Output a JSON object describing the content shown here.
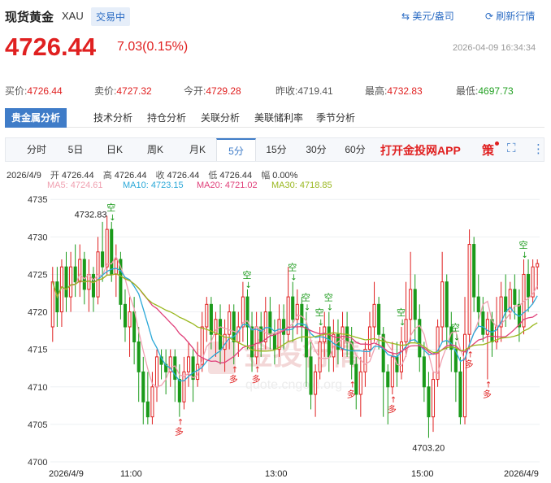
{
  "header": {
    "title": "现货黄金",
    "symbol": "XAU",
    "status": "交易中",
    "unit_label": "美元/盎司",
    "refresh_label": "刷新行情"
  },
  "quote": {
    "price": "4726.44",
    "change": "7.03(0.15%)",
    "timestamp": "2026-04-09 16:34:34"
  },
  "stats": [
    {
      "label": "买价:",
      "value": "4726.44",
      "color": "red"
    },
    {
      "label": "卖价:",
      "value": "4727.32",
      "color": "red"
    },
    {
      "label": "今开:",
      "value": "4729.28",
      "color": "red"
    },
    {
      "label": "昨收:",
      "value": "4719.41",
      "color": "plain"
    },
    {
      "label": "最高:",
      "value": "4732.83",
      "color": "red"
    },
    {
      "label": "最低:",
      "value": "4697.73",
      "color": "green"
    }
  ],
  "analysis_tabs": [
    "贵金属分析",
    "技术分析",
    "持仓分析",
    "关联分析",
    "美联储利率",
    "季节分析"
  ],
  "period_tabs": [
    "分时",
    "5日",
    "日K",
    "周K",
    "月K",
    "5分",
    "15分",
    "30分",
    "60分"
  ],
  "active_period": "5分",
  "app_link": "打开金投网APP",
  "policy_label": "策",
  "ohlc": {
    "date": "2026/4/9",
    "open_label": "开",
    "open": "4726.44",
    "high_label": "高",
    "high": "4726.44",
    "close_label": "收",
    "close": "4726.44",
    "low_label": "低",
    "low": "4726.44",
    "amp_label": "幅",
    "amp": "0.00%"
  },
  "ma": [
    {
      "label": "MA5: 4724.61",
      "color": "#f0a0b0"
    },
    {
      "label": "MA10: 4723.15",
      "color": "#2aa8d8"
    },
    {
      "label": "MA20: 4721.02",
      "color": "#e0407a"
    },
    {
      "label": "MA30: 4718.85",
      "color": "#9ab820"
    }
  ],
  "watermark": {
    "text": "金投行情",
    "url": "quote.cngold.org"
  },
  "chart_data": {
    "type": "candlestick",
    "y_ticks": [
      "4735",
      "4730",
      "4725",
      "4720",
      "4715",
      "4710",
      "4705",
      "4700"
    ],
    "ylim": [
      4700,
      4736
    ],
    "x_labels": [
      "2026/4/9",
      "11:00",
      "13:00",
      "15:00",
      "2026/4/9"
    ],
    "high_annotation": "4732.83",
    "low_annotation": "4703.20",
    "signals": {
      "short": "空",
      "long": "多"
    },
    "candles": [
      [
        4718,
        4724,
        4716,
        4726
      ],
      [
        4724,
        4720,
        4718,
        4726
      ],
      [
        4720,
        4726,
        4718,
        4727
      ],
      [
        4726,
        4722,
        4720,
        4728
      ],
      [
        4722,
        4726,
        4720,
        4728
      ],
      [
        4726,
        4724,
        4722,
        4729
      ],
      [
        4724,
        4727,
        4722,
        4729
      ],
      [
        4727,
        4723,
        4721,
        4728
      ],
      [
        4723,
        4725,
        4720,
        4727
      ],
      [
        4725,
        4722,
        4720,
        4726
      ],
      [
        4722,
        4728,
        4721,
        4730
      ],
      [
        4728,
        4726,
        4724,
        4732
      ],
      [
        4726,
        4731,
        4725,
        4732.8
      ],
      [
        4731,
        4725,
        4724,
        4732
      ],
      [
        4725,
        4727,
        4722,
        4729
      ],
      [
        4727,
        4721,
        4719,
        4728
      ],
      [
        4721,
        4718,
        4716,
        4723
      ],
      [
        4718,
        4720,
        4714,
        4722
      ],
      [
        4720,
        4716,
        4713,
        4722
      ],
      [
        4716,
        4712,
        4708,
        4718
      ],
      [
        4712,
        4708,
        4705,
        4714
      ],
      [
        4708,
        4706,
        4705,
        4712
      ],
      [
        4706,
        4710,
        4705,
        4712
      ],
      [
        4710,
        4714,
        4708,
        4715
      ],
      [
        4714,
        4713,
        4711,
        4715
      ],
      [
        4713,
        4712,
        4709,
        4715
      ],
      [
        4712,
        4714,
        4710,
        4715
      ],
      [
        4714,
        4711,
        4708,
        4715
      ],
      [
        4711,
        4708,
        4706,
        4713
      ],
      [
        4708,
        4712,
        4707,
        4714
      ],
      [
        4712,
        4714,
        4710,
        4716
      ],
      [
        4714,
        4711,
        4708,
        4715
      ],
      [
        4711,
        4713,
        4710,
        4716
      ],
      [
        4713,
        4718,
        4712,
        4720
      ],
      [
        4718,
        4721,
        4716,
        4722
      ],
      [
        4721,
        4717,
        4715,
        4722
      ],
      [
        4717,
        4719,
        4714,
        4720
      ],
      [
        4719,
        4715,
        4713,
        4721
      ],
      [
        4715,
        4717,
        4712,
        4719
      ],
      [
        4717,
        4720,
        4715,
        4721
      ],
      [
        4720,
        4716,
        4713,
        4721
      ],
      [
        4716,
        4718,
        4714,
        4720
      ],
      [
        4718,
        4722,
        4716,
        4724
      ],
      [
        4722,
        4718,
        4715,
        4723
      ],
      [
        4718,
        4714,
        4712,
        4720
      ],
      [
        4714,
        4718,
        4713,
        4720
      ],
      [
        4718,
        4716,
        4714,
        4720
      ],
      [
        4716,
        4720,
        4715,
        4722
      ],
      [
        4720,
        4717,
        4715,
        4722
      ],
      [
        4717,
        4715,
        4713,
        4719
      ],
      [
        4715,
        4719,
        4714,
        4721
      ],
      [
        4719,
        4717,
        4715,
        4721
      ],
      [
        4717,
        4722,
        4716,
        4726
      ],
      [
        4722,
        4719,
        4716,
        4724
      ],
      [
        4719,
        4721,
        4717,
        4723
      ],
      [
        4721,
        4718,
        4716,
        4722
      ],
      [
        4718,
        4714,
        4710,
        4720
      ],
      [
        4714,
        4709,
        4707,
        4716
      ],
      [
        4709,
        4712,
        4706,
        4713
      ],
      [
        4712,
        4716,
        4711,
        4718
      ],
      [
        4716,
        4718,
        4714,
        4720
      ],
      [
        4718,
        4714,
        4712,
        4720
      ],
      [
        4714,
        4717,
        4712,
        4719
      ],
      [
        4717,
        4715,
        4713,
        4719
      ],
      [
        4715,
        4718,
        4714,
        4720
      ],
      [
        4718,
        4716,
        4714,
        4720
      ],
      [
        4716,
        4713,
        4711,
        4718
      ],
      [
        4713,
        4709,
        4707,
        4714
      ],
      [
        4709,
        4712,
        4706,
        4714
      ],
      [
        4712,
        4715,
        4710,
        4716
      ],
      [
        4715,
        4718,
        4714,
        4720
      ],
      [
        4718,
        4721,
        4716,
        4724
      ],
      [
        4721,
        4717,
        4715,
        4722
      ],
      [
        4717,
        4712,
        4706,
        4718
      ],
      [
        4712,
        4710,
        4705,
        4713
      ],
      [
        4710,
        4714,
        4709,
        4716
      ],
      [
        4714,
        4712,
        4710,
        4716
      ],
      [
        4712,
        4716,
        4711,
        4718
      ],
      [
        4716,
        4719,
        4714,
        4724
      ],
      [
        4719,
        4723,
        4716,
        4728
      ],
      [
        4723,
        4719,
        4716,
        4725
      ],
      [
        4719,
        4714,
        4712,
        4721
      ],
      [
        4714,
        4710,
        4708,
        4716
      ],
      [
        4710,
        4706,
        4703.2,
        4712
      ],
      [
        4706,
        4711,
        4704,
        4712
      ],
      [
        4711,
        4718,
        4710,
        4719
      ],
      [
        4718,
        4724,
        4716,
        4728
      ],
      [
        4724,
        4718,
        4715,
        4725
      ],
      [
        4718,
        4715,
        4712,
        4720
      ],
      [
        4715,
        4712,
        4708,
        4716
      ],
      [
        4712,
        4706,
        4705,
        4714
      ],
      [
        4706,
        4717,
        4705,
        4722
      ],
      [
        4717,
        4729,
        4715,
        4731
      ],
      [
        4729,
        4722,
        4720,
        4730
      ],
      [
        4722,
        4720,
        4718,
        4725
      ],
      [
        4720,
        4717,
        4716,
        4722
      ],
      [
        4717,
        4719,
        4711,
        4720
      ],
      [
        4719,
        4716,
        4714,
        4720
      ],
      [
        4716,
        4718,
        4715,
        4722
      ],
      [
        4718,
        4722,
        4716,
        4724
      ],
      [
        4722,
        4720,
        4718,
        4725
      ],
      [
        4720,
        4723,
        4719,
        4724
      ],
      [
        4723,
        4721,
        4719,
        4725
      ],
      [
        4721,
        4718,
        4716,
        4723
      ],
      [
        4718,
        4725,
        4717,
        4727
      ],
      [
        4725,
        4722,
        4720,
        4727
      ],
      [
        4722,
        4726,
        4721,
        4727
      ],
      [
        4726,
        4726.44,
        4723,
        4727
      ]
    ]
  }
}
